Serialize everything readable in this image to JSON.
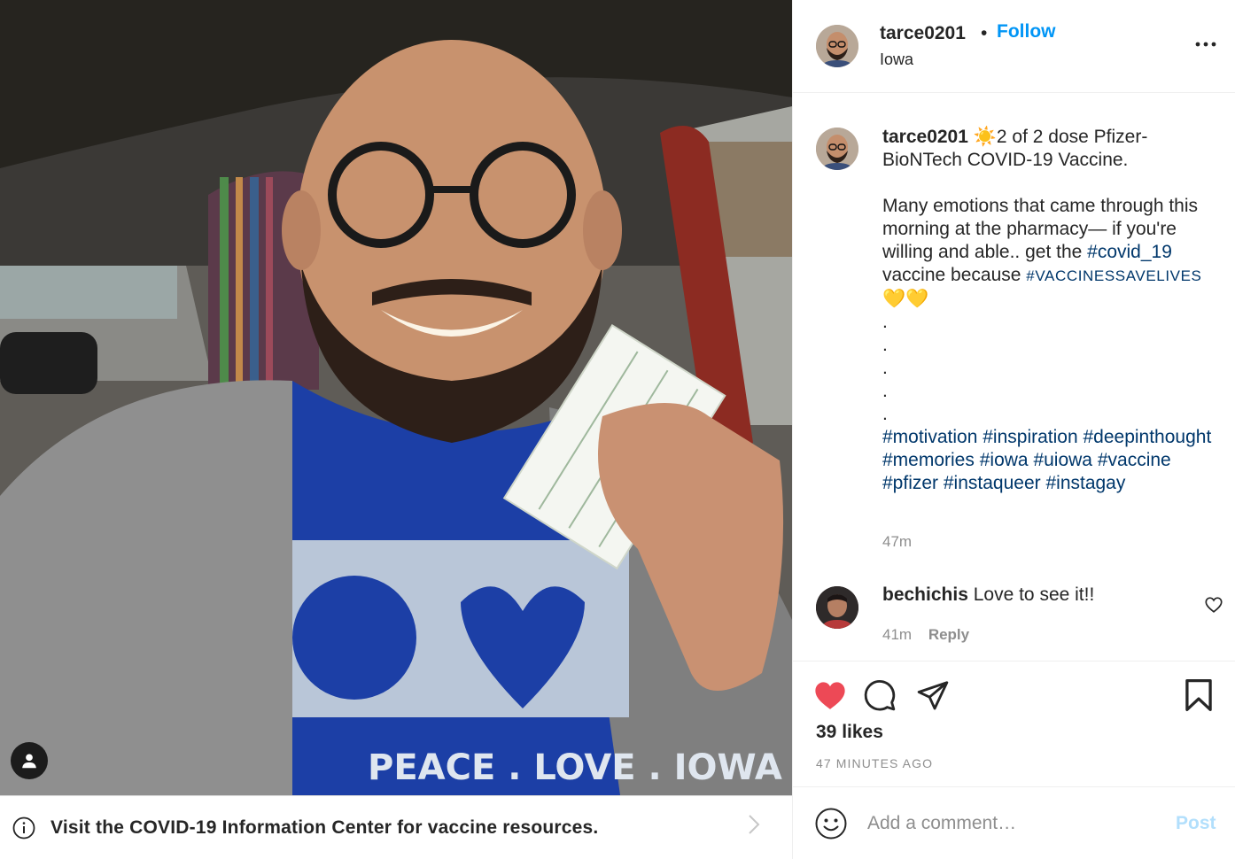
{
  "post": {
    "photo_alt": "",
    "banner_text": "Visit the COVID-19 Information Center for vaccine resources."
  },
  "header": {
    "username": "tarce0201",
    "separator": "•",
    "follow_label": "Follow",
    "location": "Iowa"
  },
  "caption": {
    "username": "tarce0201",
    "line1": "☀️2 of 2 dose Pfizer-BioNTech COVID-19 Vaccine.",
    "para2_text": "Many emotions that came through this morning at the pharmacy— if you're willing and able.. get the ",
    "tag_covid": "#covid_19",
    "para2_mid": " vaccine because ",
    "tag_vsl": "#VACCINESSAVELIVES",
    "hearts": " 💛💛",
    "dots": [
      ".",
      ".",
      ".",
      ".",
      "."
    ],
    "hashtags": [
      "#motivation",
      "#inspiration",
      "#deepinthought",
      "#memories",
      "#iowa",
      "#uiowa",
      "#vaccine",
      "#pfizer",
      "#instaqueer",
      "#instagay"
    ],
    "time": "47m"
  },
  "comment": {
    "username": "bechichis",
    "text": "Love to see it!!",
    "time": "41m",
    "reply_label": "Reply"
  },
  "actions": {
    "likes": "39 likes",
    "posted_ago": "47 MINUTES AGO"
  },
  "add_comment": {
    "placeholder": "Add a comment…",
    "post_label": "Post"
  },
  "colors": {
    "accent": "#0095f6",
    "hashtag": "#00376b",
    "like_red": "#ed4956",
    "muted": "#8e8e8e",
    "post_disabled": "#b2dffc"
  },
  "icons": [
    "person-tag-icon",
    "info-icon",
    "chevron-right-icon",
    "more-options-icon",
    "heart-outline-icon",
    "heart-filled-icon",
    "comment-icon",
    "share-icon",
    "bookmark-icon",
    "emoji-icon"
  ]
}
